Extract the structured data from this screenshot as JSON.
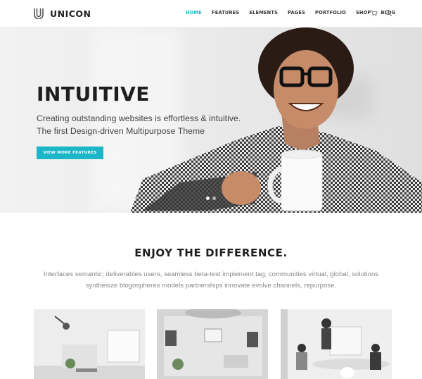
{
  "header": {
    "brand": "UNICON",
    "nav": [
      {
        "label": "HOME",
        "active": true
      },
      {
        "label": "FEATURES"
      },
      {
        "label": "ELEMENTS"
      },
      {
        "label": "PAGES"
      },
      {
        "label": "PORTFOLIO"
      },
      {
        "label": "SHOP"
      },
      {
        "label": "BLOG"
      }
    ],
    "icons": [
      "cart-icon",
      "search-icon"
    ]
  },
  "hero": {
    "title": "INTUITIVE",
    "subtitle_line1": "Creating outstanding websites is effortless & intuitive.",
    "subtitle_line2": "The first Design-driven Multipurpose Theme",
    "button": "VIEW MORE FEATURES",
    "slides": 2,
    "active_slide": 1
  },
  "section": {
    "title_regular": "ENJOY THE ",
    "title_bold": "DIFFERENCE.",
    "text": "Interfaces semantic; deliverables users, seamless beta-test implement tag, communities virtual, global, solutions synthesize blogospheres models partnerships innovate evolve channels, repurpose."
  },
  "colors": {
    "accent": "#1cb6c9",
    "dark": "#1e1e1e",
    "muted": "#888888"
  }
}
